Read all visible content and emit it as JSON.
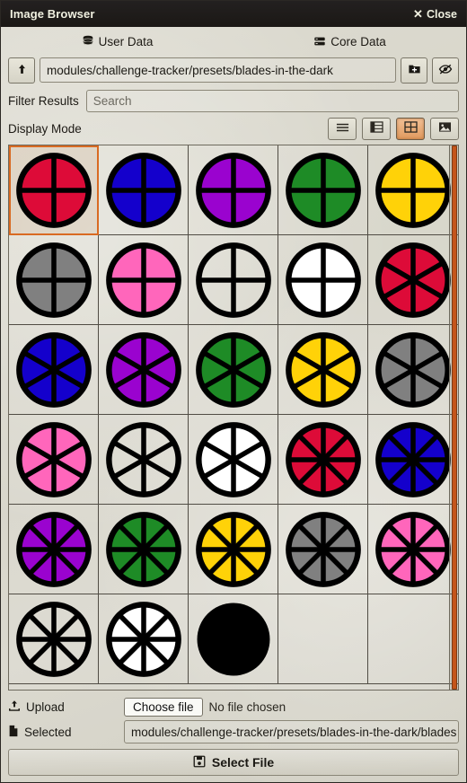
{
  "window": {
    "title": "Image Browser",
    "close_label": "Close",
    "close_icon": "close-x-icon"
  },
  "sources": [
    {
      "label": "User Data",
      "icon": "database-icon",
      "active": true
    },
    {
      "label": "Core Data",
      "icon": "server-icon",
      "active": false
    }
  ],
  "path_bar": {
    "parent_button_icon": "arrow-up-icon",
    "path_value": "modules/challenge-tracker/presets/blades-in-the-dark",
    "new_folder_icon": "folder-plus-icon",
    "toggle_hidden_icon": "eye-slash-icon"
  },
  "filter": {
    "label": "Filter Results",
    "value": "",
    "placeholder": "Search"
  },
  "display_mode": {
    "label": "Display Mode",
    "selected": "tiles",
    "modes": [
      {
        "id": "list",
        "icon": "list-icon",
        "active": false
      },
      {
        "id": "details",
        "icon": "table-icon",
        "active": false
      },
      {
        "id": "tiles",
        "icon": "grid-icon",
        "active": true
      },
      {
        "id": "images",
        "icon": "image-icon",
        "active": false
      }
    ]
  },
  "accent_color": "#d96a22",
  "scrollbar": {
    "thumb_color": "#c4551b",
    "position": "top"
  },
  "palette": {
    "crimson": "#dd0b38",
    "blue": "#1400cc",
    "purple": "#9a03cf",
    "green": "#1e8b26",
    "yellow": "#ffd208",
    "grey": "#808080",
    "pink": "#ff66bb",
    "white": "#ffffff",
    "transparent": "none",
    "black": "#000000",
    "stroke": "#000000"
  },
  "grid": {
    "columns": 5,
    "selected_index": 0,
    "items": [
      {
        "name": "clock-4-crimson",
        "segments": 4,
        "fill": "crimson",
        "selected": true
      },
      {
        "name": "clock-4-blue",
        "segments": 4,
        "fill": "blue",
        "selected": false
      },
      {
        "name": "clock-4-purple",
        "segments": 4,
        "fill": "purple",
        "selected": false
      },
      {
        "name": "clock-4-green",
        "segments": 4,
        "fill": "green",
        "selected": false
      },
      {
        "name": "clock-4-yellow",
        "segments": 4,
        "fill": "yellow",
        "selected": false
      },
      {
        "name": "clock-4-grey",
        "segments": 4,
        "fill": "grey",
        "selected": false
      },
      {
        "name": "clock-4-pink",
        "segments": 4,
        "fill": "pink",
        "selected": false
      },
      {
        "name": "clock-4-transparent",
        "segments": 4,
        "fill": "transparent",
        "selected": false
      },
      {
        "name": "clock-4-white",
        "segments": 4,
        "fill": "white",
        "selected": false
      },
      {
        "name": "clock-6-crimson",
        "segments": 6,
        "fill": "crimson",
        "selected": false
      },
      {
        "name": "clock-6-blue",
        "segments": 6,
        "fill": "blue",
        "selected": false
      },
      {
        "name": "clock-6-purple",
        "segments": 6,
        "fill": "purple",
        "selected": false
      },
      {
        "name": "clock-6-green",
        "segments": 6,
        "fill": "green",
        "selected": false
      },
      {
        "name": "clock-6-yellow",
        "segments": 6,
        "fill": "yellow",
        "selected": false
      },
      {
        "name": "clock-6-grey",
        "segments": 6,
        "fill": "grey",
        "selected": false
      },
      {
        "name": "clock-6-pink",
        "segments": 6,
        "fill": "pink",
        "selected": false
      },
      {
        "name": "clock-6-transparent",
        "segments": 6,
        "fill": "transparent",
        "selected": false
      },
      {
        "name": "clock-6-white",
        "segments": 6,
        "fill": "white",
        "selected": false
      },
      {
        "name": "clock-8-crimson",
        "segments": 8,
        "fill": "crimson",
        "selected": false
      },
      {
        "name": "clock-8-blue",
        "segments": 8,
        "fill": "blue",
        "selected": false
      },
      {
        "name": "clock-8-purple",
        "segments": 8,
        "fill": "purple",
        "selected": false
      },
      {
        "name": "clock-8-green",
        "segments": 8,
        "fill": "green",
        "selected": false
      },
      {
        "name": "clock-8-yellow",
        "segments": 8,
        "fill": "yellow",
        "selected": false
      },
      {
        "name": "clock-8-grey",
        "segments": 8,
        "fill": "grey",
        "selected": false
      },
      {
        "name": "clock-8-pink",
        "segments": 8,
        "fill": "pink",
        "selected": false
      },
      {
        "name": "clock-8-transparent",
        "segments": 8,
        "fill": "transparent",
        "selected": false
      },
      {
        "name": "clock-8-white",
        "segments": 8,
        "fill": "white",
        "selected": false
      },
      {
        "name": "clock-filled-black",
        "segments": 0,
        "fill": "black",
        "selected": false
      },
      {
        "name": "empty-cell",
        "segments": -1,
        "fill": "none",
        "selected": false
      },
      {
        "name": "empty-cell",
        "segments": -1,
        "fill": "none",
        "selected": false
      }
    ]
  },
  "footer": {
    "upload_label": "Upload",
    "upload_icon": "upload-icon",
    "choose_file_label": "Choose file",
    "no_file_label": "No file chosen",
    "selected_label": "Selected",
    "selected_icon": "file-icon",
    "selected_value": "modules/challenge-tracker/presets/blades-in-the-dark/blades",
    "select_file_label": "Select File",
    "select_file_icon": "save-icon"
  }
}
